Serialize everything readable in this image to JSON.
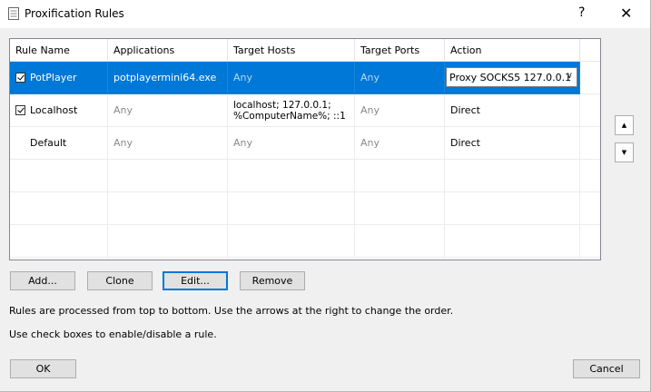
{
  "window": {
    "title": "Proxification Rules",
    "help_label": "?",
    "close_label": "✕"
  },
  "table": {
    "columns": [
      "Rule Name",
      "Applications",
      "Target Hosts",
      "Target Ports",
      "Action"
    ],
    "rows": [
      {
        "checked": true,
        "name": "PotPlayer",
        "applications": "potplayermini64.exe",
        "target_hosts": "Any",
        "target_ports": "Any",
        "action": "Proxy SOCKS5 127.0.0.1",
        "selected": true
      },
      {
        "checked": true,
        "name": "Localhost",
        "applications": "Any",
        "target_hosts_line1": "localhost; 127.0.0.1;",
        "target_hosts_line2": "%ComputerName%; ::1",
        "target_ports": "Any",
        "action": "Direct"
      },
      {
        "checked": false,
        "name": "Default",
        "applications": "Any",
        "target_hosts": "Any",
        "target_ports": "Any",
        "action": "Direct"
      }
    ]
  },
  "order_buttons": {
    "up": "▲",
    "down": "▼"
  },
  "actions": {
    "add": "Add...",
    "clone": "Clone",
    "edit": "Edit...",
    "remove": "Remove"
  },
  "info": {
    "line1": "Rules are processed from top to bottom. Use the arrows at the right to change the order.",
    "line2": "Use check boxes to enable/disable a rule."
  },
  "footer": {
    "ok": "OK",
    "cancel": "Cancel"
  }
}
